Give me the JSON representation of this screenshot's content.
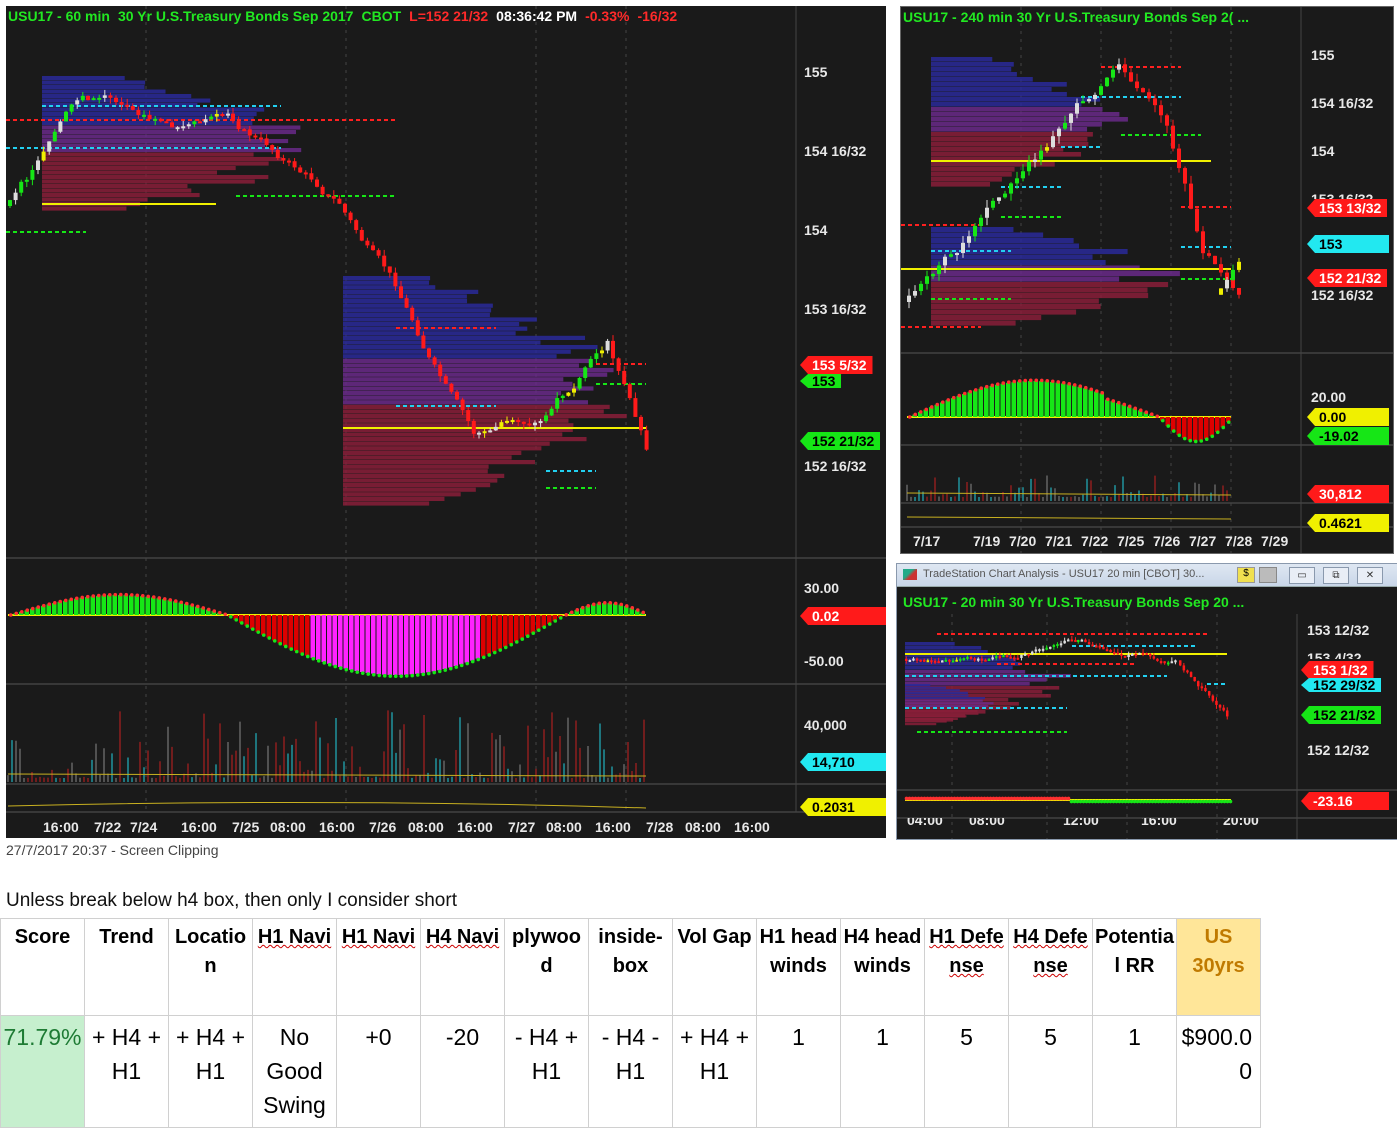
{
  "main_chart": {
    "title": {
      "symbol": "USU17 - 60 min",
      "desc": "30 Yr U.S.Treasury Bonds Sep 2017",
      "exchange": "CBOT",
      "last": "L=152 21/32",
      "time": "08:36:42 PM",
      "pct": "-0.33%",
      "chg": "-16/32"
    },
    "price_axis": [
      "155",
      "154 16/32",
      "154",
      "153 16/32",
      "152 16/32"
    ],
    "tags": [
      {
        "text": "153 5/32",
        "bg": "#ff1a1a",
        "fg": "#fff"
      },
      {
        "text": "153",
        "bg": "#16e616",
        "fg": "#000"
      },
      {
        "text": "152 21/32",
        "bg": "#16e616",
        "fg": "#000"
      }
    ],
    "osc_axis": [
      "30.00",
      "-50.00"
    ],
    "osc_tag": {
      "text": "0.02",
      "bg": "#ff1a1a",
      "fg": "#fff"
    },
    "vol_axis": [
      "40,000"
    ],
    "vol_tag": {
      "text": "14,710",
      "bg": "#22e8f0",
      "fg": "#000"
    },
    "ind_tag": {
      "text": "0.2031",
      "bg": "#f0f000",
      "fg": "#000"
    },
    "time_axis": [
      "16:00",
      "7/22",
      "7/24",
      "16:00",
      "7/25",
      "08:00",
      "16:00",
      "7/26",
      "08:00",
      "16:00",
      "7/27",
      "08:00",
      "16:00",
      "7/28",
      "08:00",
      "16:00"
    ]
  },
  "h4_chart": {
    "title": "USU17 - 240 min  30 Yr U.S.Treasury Bonds Sep 2( ...",
    "price_axis": [
      "155",
      "154 16/32",
      "154",
      "153 16/32",
      "152 16/32"
    ],
    "tags": [
      {
        "text": "153 13/32",
        "bg": "#ff1a1a",
        "fg": "#fff"
      },
      {
        "text": "153",
        "bg": "#22e8f0",
        "fg": "#000"
      },
      {
        "text": "152 21/32",
        "bg": "#ff1a1a",
        "fg": "#fff"
      }
    ],
    "osc_axis": [
      "20.00"
    ],
    "osc_tags": [
      {
        "text": "0.00",
        "bg": "#f0f000",
        "fg": "#000"
      },
      {
        "text": "-19.02",
        "bg": "#16e616",
        "fg": "#000"
      }
    ],
    "vol_tag": {
      "text": "30,812",
      "bg": "#ff1a1a",
      "fg": "#fff"
    },
    "ind_tag": {
      "text": "0.4621",
      "bg": "#f0f000",
      "fg": "#000"
    },
    "time_axis": [
      "7/17",
      "7/19",
      "7/20",
      "7/21",
      "7/22",
      "7/25",
      "7/26",
      "7/27",
      "7/28",
      "7/29"
    ]
  },
  "m20_window": {
    "window_title": "TradeStation Chart Analysis - USU17 20 min [CBOT] 30...",
    "title": "USU17 - 20 min  30 Yr U.S.Treasury Bonds Sep 20 ...",
    "price_axis": [
      "153 12/32",
      "153 4/32",
      "152 12/32"
    ],
    "tags": [
      {
        "text": "153 1/32",
        "bg": "#ff1a1a",
        "fg": "#fff"
      },
      {
        "text": "152 29/32",
        "bg": "#22e8f0",
        "fg": "#000"
      },
      {
        "text": "152 21/32",
        "bg": "#16e616",
        "fg": "#000"
      }
    ],
    "osc_tag": {
      "text": "-23.16",
      "bg": "#ff1a1a",
      "fg": "#fff"
    },
    "time_axis": [
      "04:00",
      "08:00",
      "12:00",
      "16:00",
      "20:00"
    ],
    "buttons": {
      "min": "▭",
      "restore": "⧉",
      "close": "✕"
    }
  },
  "caption": "27/7/2017 20:37 - Screen Clipping",
  "note": "Unless break below h4 box, then only I consider short",
  "table": {
    "headers": [
      "Score",
      "Trend",
      "Location",
      "H1 Navi",
      "H1 Navi",
      "H4 Navi",
      "plywood",
      "inside-box",
      "Vol Gap",
      "H1 headwinds",
      "H4 headwinds",
      "H1 Defense",
      "H4 Defense",
      "Potential RR",
      "US 30yrs"
    ],
    "row": [
      "71.79%",
      "+ H4 + H1",
      "+ H4 + H1",
      "No Good Swing",
      "+0",
      "-20",
      "- H4 + H1",
      "- H4 - H1",
      "+ H4 + H1",
      "1",
      "1",
      "5",
      "5",
      "1",
      "$900.00"
    ],
    "colors": {
      "score_bg": "#c6efce",
      "score_fg": "#1e7b34",
      "us_bg": "#ffe699",
      "us_fg": "#c07a00"
    }
  }
}
